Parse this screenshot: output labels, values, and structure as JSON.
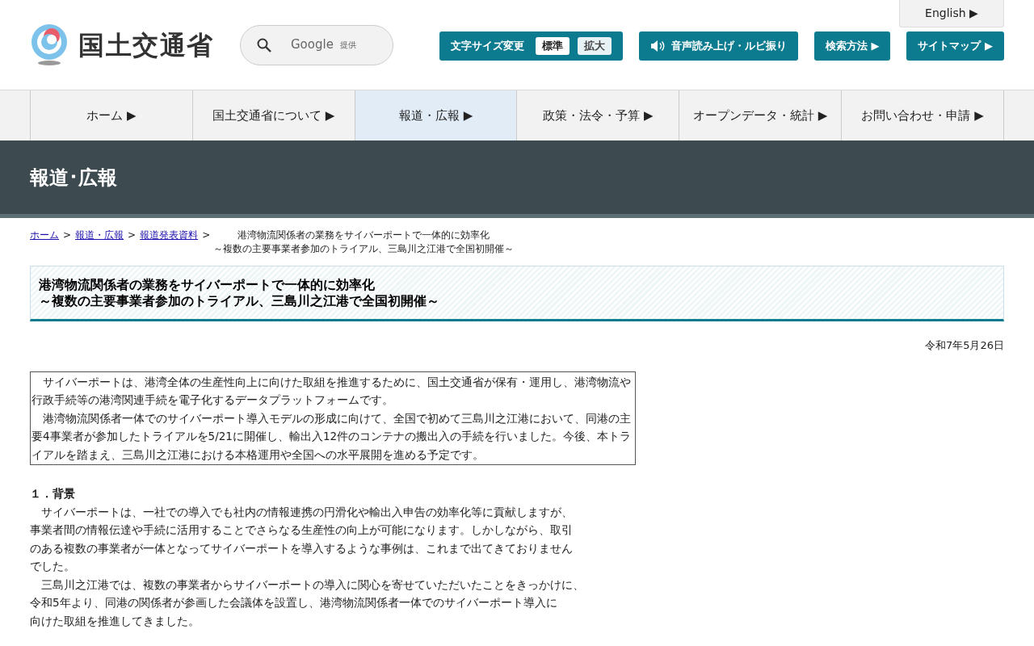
{
  "header": {
    "logo_text": "国土交通省",
    "search": {
      "placeholder": "Google",
      "provider": "提供"
    },
    "english": "English ▶",
    "font_size": {
      "label": "文字サイズ変更",
      "options": [
        {
          "label": "標準",
          "selected": true
        },
        {
          "label": "拡大",
          "selected": false
        }
      ]
    },
    "buttons": [
      {
        "kind": "speaker",
        "label": "音声読み上げ・ルビ振り"
      },
      {
        "kind": "arrow",
        "label": "検索方法 ▶"
      },
      {
        "kind": "arrow",
        "label": "サイトマップ ▶"
      }
    ]
  },
  "nav": [
    {
      "label": "ホーム ▶",
      "selected": false
    },
    {
      "label": "国土交通省について ▶",
      "selected": false
    },
    {
      "label": "報道・広報 ▶",
      "selected": true
    },
    {
      "label": "政策・法令・予算 ▶",
      "selected": false
    },
    {
      "label": "オープンデータ・統計 ▶",
      "selected": false
    },
    {
      "label": "お問い合わせ・申請 ▶",
      "selected": false
    }
  ],
  "banner_title": "報道･広報",
  "breadcrumbs": {
    "links": [
      "ホーム",
      "報道・広報",
      "報道発表資料"
    ],
    "separator": ">",
    "current": [
      "港湾物流関係者の業務をサイバーポートで一体的に効率化",
      "～複数の主要事業者参加のトライアル、三島川之江港で全国初開催～"
    ]
  },
  "title": [
    "港湾物流関係者の業務をサイバーポートで一体的に効率化",
    "～複数の主要事業者参加のトライアル、三島川之江港で全国初開催～"
  ],
  "date": "令和7年5月26日",
  "summary": [
    [
      "　サイバーポートは、港湾全体の生産性向上に向けた取組を推進するために、国土交通省が保有・運用し、港湾物流や",
      "行政手続等の港湾関連手続を電子化するデータプラットフォームです。"
    ],
    [
      "　港湾物流関係者一体でのサイバーポート導入モデルの形成に向けて、全国で初めて三島川之江港において、同港の主",
      "要4事業者が参加したトライアルを5/21に開催し、輸出入12件のコンテナの搬出入の手続を行いました。今後、本トラ",
      "イアルを踏まえ、三島川之江港における本格運用や全国への水平展開を進める予定です。"
    ]
  ],
  "section": {
    "heading": "１．背景",
    "paragraphs": [
      [
        "　サイバーポートは、一社での導入でも社内の情報連携の円滑化や輸出入申告の効率化等に貢献しますが、",
        "事業者間の情報伝達や手続に活用することでさらなる生産性の向上が可能になります。しかしながら、取引",
        "のある複数の事業者が一体となってサイバーポートを導入するような事例は、これまで出てきておりません",
        "でした。"
      ],
      [
        "　三島川之江港では、複数の事業者からサイバーポートの導入に関心を寄せていただいたことをきっかけに、",
        "令和5年より、同港の関係者が参画した会議体を設置し、港湾物流関係者一体でのサイバーポート導入に",
        "向けた取組を推進してきました。"
      ]
    ]
  }
}
